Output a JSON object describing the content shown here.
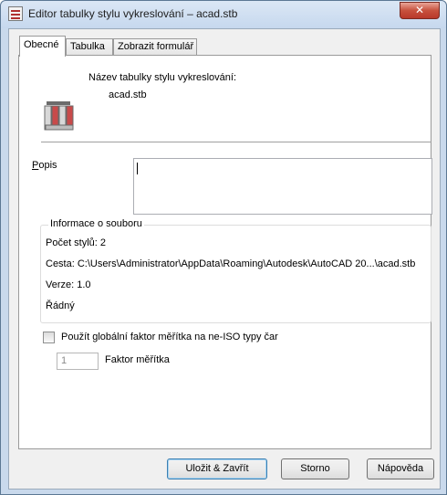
{
  "window": {
    "title": "Editor tabulky stylu vykreslování – acad.stb",
    "close_glyph": "✕",
    "title_icon": "plot-style-table-icon"
  },
  "tabs": [
    {
      "label": "Obecné",
      "active": true
    },
    {
      "label": "Tabulka",
      "active": false
    },
    {
      "label": "Zobrazit formulář",
      "active": false
    }
  ],
  "general": {
    "table_name_label": "Název tabulky stylu vykreslování:",
    "table_name_value": "acad.stb",
    "app_icon": "plot-style-table-icon",
    "description_label": "Popis",
    "description_value": "",
    "file_info": {
      "legend": "Informace o souboru",
      "style_count": "Počet stylů: 2",
      "path": "Cesta: C:\\Users\\Administrator\\AppData\\Roaming\\Autodesk\\AutoCAD 20...\\acad.stb",
      "version": "Verze: 1.0",
      "status": "Řádný"
    },
    "use_global_scale": {
      "label": "Použít globální faktor měřítka na ne-ISO typy čar",
      "checked": false
    },
    "scale_factor": {
      "value": "1",
      "label": "Faktor měřítka"
    }
  },
  "buttons": {
    "save_close": "Uložit & Zavřít",
    "cancel": "Storno",
    "help": "Nápověda"
  },
  "colors": {
    "titlebar": "#c9d9ec",
    "close_button": "#c7513d",
    "default_button_border": "#3c7fb1"
  }
}
